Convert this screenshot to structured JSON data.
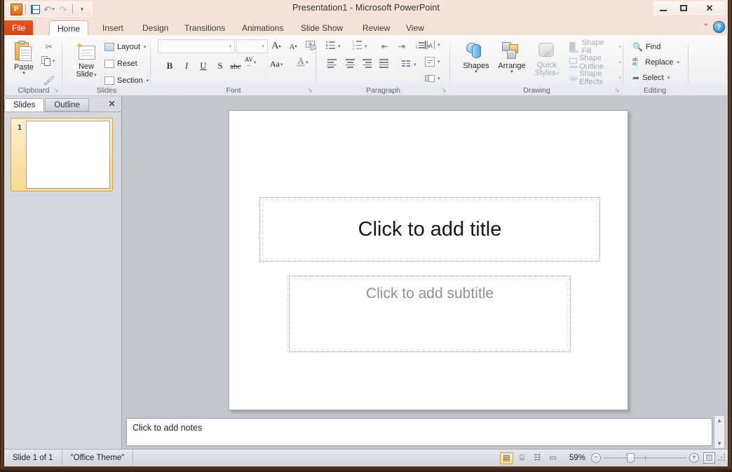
{
  "window": {
    "title": "Presentation1  -  Microsoft PowerPoint",
    "minimize": "–",
    "maximize": "□",
    "close": "✕"
  },
  "qat": {
    "logo": "P",
    "save_icon": "save-icon",
    "undo_icon": "↶",
    "redo_icon": "↷",
    "customize_icon": "▾"
  },
  "ribbon": {
    "tabs": [
      {
        "label": "File",
        "active": false,
        "file": true
      },
      {
        "label": "Home",
        "active": true
      },
      {
        "label": "Insert",
        "active": false
      },
      {
        "label": "Design",
        "active": false
      },
      {
        "label": "Transitions",
        "active": false
      },
      {
        "label": "Animations",
        "active": false
      },
      {
        "label": "Slide Show",
        "active": false
      },
      {
        "label": "Review",
        "active": false
      },
      {
        "label": "View",
        "active": false
      }
    ],
    "collapse_icon": "⌃",
    "help_icon": "?",
    "groups": {
      "clipboard": {
        "label": "Clipboard",
        "paste": "Paste",
        "paste_arrow": "▾",
        "cut": "✂",
        "copy": "copy-icon",
        "format_painter": "format-painter-icon",
        "copy_arrow": "▾",
        "launcher": "↘"
      },
      "slides": {
        "label": "Slides",
        "new_slide_line1": "New",
        "new_slide_line2": "Slide",
        "new_slide_arrow": "▾",
        "layout": "Layout",
        "layout_arrow": "▾",
        "reset": "Reset",
        "section": "Section",
        "section_arrow": "▾"
      },
      "font": {
        "label": "Font",
        "font_name_value": "",
        "font_size_value": "",
        "grow_font": "A",
        "shrink_font": "A",
        "clear_formatting": "clear-formatting-icon",
        "bold": "B",
        "italic": "I",
        "underline": "U",
        "shadow": "S",
        "strikethrough": "abc",
        "char_spacing": "AV",
        "change_case": "Aa",
        "font_color": "A",
        "launcher": "↘"
      },
      "paragraph": {
        "label": "Paragraph",
        "bullets": "bullets-icon",
        "numbering": "numbering-icon",
        "decrease_indent": "decrease-indent-icon",
        "increase_indent": "increase-indent-icon",
        "line_spacing": "line-spacing-icon",
        "text_direction": "text-direction-icon",
        "align_text": "align-text-icon",
        "smart_art": "convert-to-smartart-icon",
        "align_left": "align-left-icon",
        "align_center": "align-center-icon",
        "align_right": "align-right-icon",
        "justify": "justify-icon",
        "columns": "columns-icon",
        "launcher": "↘"
      },
      "drawing": {
        "label": "Drawing",
        "shapes": "Shapes",
        "shapes_arrow": "▾",
        "arrange": "Arrange",
        "arrange_arrow": "▾",
        "quick_styles_line1": "Quick",
        "quick_styles_line2": "Styles",
        "quick_styles_arrow": "▾",
        "shape_fill": "Shape Fill",
        "shape_outline": "Shape Outline",
        "shape_effects": "Shape Effects",
        "dropdown_arrow": "▾",
        "launcher": "↘"
      },
      "editing": {
        "label": "Editing",
        "find": "Find",
        "replace": "Replace",
        "select": "Select",
        "dropdown_arrow": "▾"
      }
    }
  },
  "slides_pane": {
    "tabs": [
      {
        "label": "Slides",
        "active": true
      },
      {
        "label": "Outline",
        "active": false
      }
    ],
    "close_icon": "✕",
    "thumbnail_number": "1"
  },
  "slide": {
    "title_placeholder": "Click to add title",
    "subtitle_placeholder": "Click to add subtitle"
  },
  "notes": {
    "placeholder": "Click to add notes",
    "scroll_up": "▲",
    "scroll_down": "▼"
  },
  "status_bar": {
    "slide_counter": "Slide 1 of 1",
    "theme": "\"Office Theme\"",
    "views": [
      {
        "name": "normal-view",
        "glyph": "▤",
        "active": true
      },
      {
        "name": "slide-sorter-view",
        "glyph": "⌸",
        "active": false
      },
      {
        "name": "reading-view",
        "glyph": "☷",
        "active": false
      },
      {
        "name": "slide-show-view",
        "glyph": "▭",
        "active": false
      }
    ],
    "zoom_percent": "59%",
    "zoom_out": "−",
    "zoom_in": "+",
    "fit_to_window": "fit-slide-to-window-icon"
  },
  "colors": {
    "accent_orange": "#e8551f",
    "selection_gold": "#e3a23d",
    "title_text": "#171717",
    "placeholder_gray": "#8e9296"
  }
}
